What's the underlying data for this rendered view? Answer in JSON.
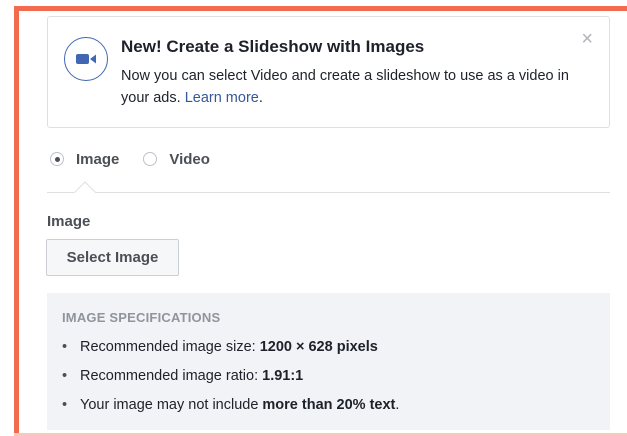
{
  "notice": {
    "icon": "video-camera-icon",
    "title": "New! Create a Slideshow with Images",
    "body": "Now you can select Video and create a slideshow to use as a video in your ads.",
    "link": "Learn more",
    "link_suffix": ".",
    "close": "×",
    "colors": {
      "icon": "#4267b2",
      "link": "#365899"
    }
  },
  "format": {
    "options": [
      {
        "label": "Image",
        "selected": true
      },
      {
        "label": "Video",
        "selected": false
      }
    ]
  },
  "image_section": {
    "label": "Image",
    "button": "Select Image"
  },
  "specs": {
    "heading": "IMAGE SPECIFICATIONS",
    "items": [
      {
        "text": "Recommended image size:",
        "bold": "1200 × 628 pixels",
        "tail": ""
      },
      {
        "text": "Recommended image ratio:",
        "bold": "1.91:1",
        "tail": ""
      },
      {
        "text": "Your image may not include",
        "bold": "more than 20% text",
        "tail": "."
      }
    ]
  },
  "colors": {
    "accent_border": "#f26b4f",
    "panel_bg": "#f1f3f6"
  }
}
